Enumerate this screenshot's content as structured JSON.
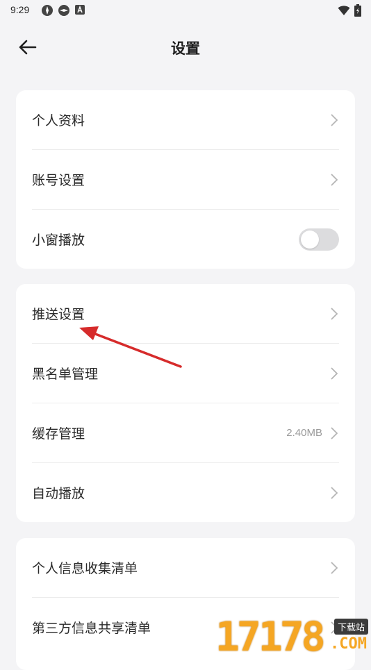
{
  "status": {
    "time": "9:29"
  },
  "header": {
    "title": "设置"
  },
  "groups": [
    {
      "items": [
        {
          "label": "个人资料"
        },
        {
          "label": "账号设置"
        },
        {
          "label": "小窗播放"
        }
      ]
    },
    {
      "items": [
        {
          "label": "推送设置"
        },
        {
          "label": "黑名单管理"
        },
        {
          "label": "缓存管理",
          "value": "2.40MB"
        },
        {
          "label": "自动播放"
        }
      ]
    },
    {
      "items": [
        {
          "label": "个人信息收集清单"
        },
        {
          "label": "第三方信息共享清单"
        }
      ]
    }
  ],
  "toggles": {
    "mini_window": false
  },
  "watermark": {
    "digits": "17178",
    "badge": "下载站",
    "domain": ".COM"
  },
  "colors": {
    "annotation_arrow": "#d62b2b",
    "watermark": "#f5a623"
  }
}
